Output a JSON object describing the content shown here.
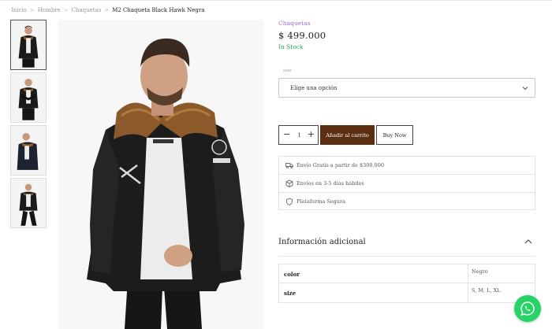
{
  "breadcrumb": {
    "items": [
      "Inicio",
      "Hombre",
      "Chaquetas"
    ],
    "current": "M2 Chaqueta Black Hawk Negra",
    "separator": ">"
  },
  "gallery": {
    "thumbnails": [
      {
        "icon": "product-thumbnail-front"
      },
      {
        "icon": "product-thumbnail-pose"
      },
      {
        "icon": "product-thumbnail-side"
      },
      {
        "icon": "product-thumbnail-walk"
      }
    ],
    "main_image": "product-main-image"
  },
  "product": {
    "category": "Chaquetas",
    "price": "$ 499.000",
    "stock": "In Stock",
    "size_label": "size",
    "size_select": "Elige una opción",
    "quantity": "1",
    "quantity_minus": "−",
    "quantity_plus": "+",
    "add_to_cart": "Añadir al carrito",
    "buy_now": "Buy Now"
  },
  "features": [
    {
      "icon": "truck-icon",
      "text": "Envío Gratis a partir de $300.000"
    },
    {
      "icon": "box-icon",
      "text": "Envíos en 3-5 días hábiles"
    },
    {
      "icon": "shield-icon",
      "text": "Plataforma Segura"
    }
  ],
  "additional_info": {
    "title": "Información adicional",
    "rows": [
      {
        "key": "color",
        "value": "Negro"
      },
      {
        "key": "size",
        "value": "S, M, L, XL"
      }
    ]
  },
  "colors": {
    "accent_brown": "#5a2e0f",
    "stock_green": "#2ea44f",
    "category_purple": "#9b6fd1",
    "whatsapp_green": "#25d366"
  }
}
